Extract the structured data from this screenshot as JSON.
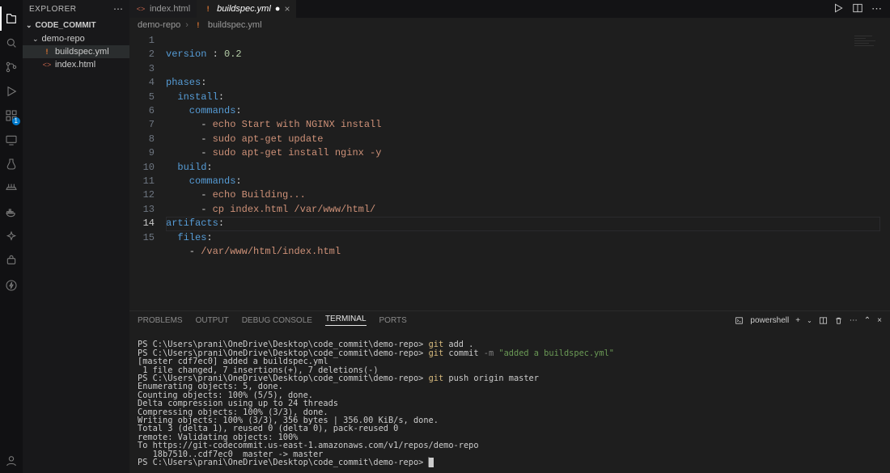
{
  "activity": {
    "explorer": "Explorer",
    "badge": "1"
  },
  "sidebar": {
    "title": "EXPLORER",
    "section": "CODE_COMMIT",
    "folder": "demo-repo",
    "files": [
      {
        "name": "buildspec.yml",
        "icon": "!",
        "iconColor": "#e37933"
      },
      {
        "name": "index.html",
        "icon": "<>",
        "iconColor": "#c0624a"
      }
    ]
  },
  "tabs": [
    {
      "label": "index.html",
      "icon": "<>",
      "iconColor": "#c0624a",
      "active": false,
      "dirty": false
    },
    {
      "label": "buildspec.yml",
      "icon": "!",
      "iconColor": "#e37933",
      "active": true,
      "dirty": true
    }
  ],
  "breadcrumb": {
    "a": "demo-repo",
    "b": "buildspec.yml",
    "bIcon": "!"
  },
  "editor": {
    "lines": 15,
    "current": 14
  },
  "code": {
    "l1a": "version ",
    "l1b": ":",
    "l1c": " 0.2",
    "l3a": "phases",
    "l3b": ":",
    "l4a": "  install",
    "l4b": ":",
    "l5a": "    commands",
    "l5b": ":",
    "l6a": "      - ",
    "l6b": "echo Start with NGINX install",
    "l7a": "      - ",
    "l7b": "sudo apt-get update",
    "l8a": "      - ",
    "l8b": "sudo apt-get install nginx -y",
    "l9a": "  build",
    "l9b": ":",
    "l10a": "    commands",
    "l10b": ":",
    "l11a": "      - ",
    "l11b": "echo Building...",
    "l12a": "      - ",
    "l12b": "cp index.html /var/www/html/",
    "l13a": "artifacts",
    "l13b": ":",
    "l14a": "  files",
    "l14b": ":",
    "l15a": "    - ",
    "l15b": "/var/www/html/index.html"
  },
  "panel": {
    "tabs": {
      "problems": "PROBLEMS",
      "output": "OUTPUT",
      "debug": "DEBUG CONSOLE",
      "terminal": "TERMINAL",
      "ports": "PORTS"
    },
    "shell": "powershell"
  },
  "term": {
    "prompt": "PS C:\\Users\\prani\\OneDrive\\Desktop\\code_commit\\demo-repo> ",
    "c1": "git",
    "c1a": " add .",
    "c2": "git",
    "c2a": " commit ",
    "c2f": "-m ",
    "c2s": "\"added a buildspec.yml\"",
    "l3": "[master cdf7ec0] added a buildspec.yml",
    "l4": " 1 file changed, 7 insertions(+), 7 deletions(-)",
    "c3": "git",
    "c3a": " push origin master",
    "l6": "Enumerating objects: 5, done.",
    "l7": "Counting objects: 100% (5/5), done.",
    "l8": "Delta compression using up to 24 threads",
    "l9": "Compressing objects: 100% (3/3), done.",
    "l10": "Writing objects: 100% (3/3), 356 bytes | 356.00 KiB/s, done.",
    "l11": "Total 3 (delta 1), reused 0 (delta 0), pack-reused 0",
    "l12": "remote: Validating objects: 100%",
    "l13": "To https://git-codecommit.us-east-1.amazonaws.com/v1/repos/demo-repo",
    "l14": "   18b7510..cdf7ec0  master -> master",
    "cursor": "▏"
  }
}
